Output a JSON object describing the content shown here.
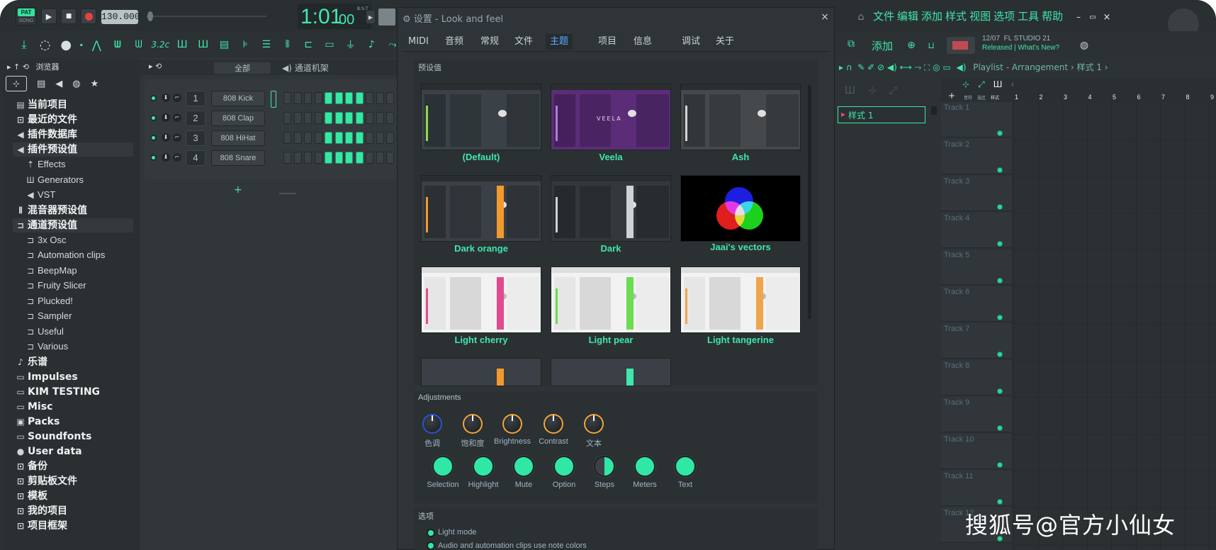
{
  "transport": {
    "pat": "PAT",
    "song": "SONG",
    "tempo": "130.000",
    "time_main": "1:01",
    "time_sub": "00",
    "bst": "B:S:T"
  },
  "menu": [
    "文件",
    "编辑",
    "添加",
    "样式",
    "视图",
    "选项",
    "工具",
    "帮助"
  ],
  "hint": {
    "date": "12/07",
    "app": "FL STUDIO 21",
    "line2": "Released | What's New?"
  },
  "playlist_bar": {
    "add": "添加",
    "title": "Playlist - Arrangement",
    "pattern": "样式 1"
  },
  "toolbar_small": {
    "sig": "3.2c"
  },
  "browser": {
    "title": "浏览器",
    "items": [
      {
        "icon": "file-icon",
        "label": "当前项目",
        "level": 0
      },
      {
        "icon": "folder-link-icon",
        "label": "最近的文件",
        "level": 0
      },
      {
        "icon": "plugin-icon",
        "label": "插件数据库",
        "level": 0
      },
      {
        "icon": "plugin-icon",
        "label": "插件预设值",
        "level": 0
      },
      {
        "icon": "plugin-link-icon",
        "label": "Effects",
        "level": 1
      },
      {
        "icon": "piano-icon",
        "label": "Generators",
        "level": 1
      },
      {
        "icon": "plugin-icon",
        "label": "VST",
        "level": 1
      },
      {
        "icon": "mixer-icon",
        "label": "混音器预设值",
        "level": 0
      },
      {
        "icon": "channel-icon",
        "label": "通道预设值",
        "level": 0
      },
      {
        "icon": "channel-icon",
        "label": "3x Osc",
        "level": 1
      },
      {
        "icon": "channel-icon",
        "label": "Automation clips",
        "level": 1
      },
      {
        "icon": "channel-icon",
        "label": "BeepMap",
        "level": 1
      },
      {
        "icon": "channel-icon",
        "label": "Fruity Slicer",
        "level": 1
      },
      {
        "icon": "channel-icon",
        "label": "Plucked!",
        "level": 1
      },
      {
        "icon": "channel-icon",
        "label": "Sampler",
        "level": 1
      },
      {
        "icon": "channel-icon",
        "label": "Useful",
        "level": 1
      },
      {
        "icon": "channel-icon",
        "label": "Various",
        "level": 1
      },
      {
        "icon": "note-icon",
        "label": "乐谱",
        "level": 0
      },
      {
        "icon": "folder-icon",
        "label": "Impulses",
        "level": 0
      },
      {
        "icon": "folder-icon",
        "label": "KIM TESTING",
        "level": 0
      },
      {
        "icon": "folder-icon",
        "label": "Misc",
        "level": 0
      },
      {
        "icon": "box-icon",
        "label": "Packs",
        "level": 0
      },
      {
        "icon": "folder-icon",
        "label": "Soundfonts",
        "level": 0
      },
      {
        "icon": "user-icon",
        "label": "User data",
        "level": 0
      },
      {
        "icon": "folder-link-icon",
        "label": "备份",
        "level": 0
      },
      {
        "icon": "folder-link-icon",
        "label": "剪贴板文件",
        "level": 0
      },
      {
        "icon": "folder-link-icon",
        "label": "模板",
        "level": 0
      },
      {
        "icon": "folder-link-icon",
        "label": "我的项目",
        "level": 0
      },
      {
        "icon": "folder-link-icon",
        "label": "项目框架",
        "level": 0
      }
    ]
  },
  "channel_rack": {
    "filter": "全部",
    "title": "通道机架",
    "channels": [
      {
        "num": "1",
        "name": "808 Kick"
      },
      {
        "num": "2",
        "name": "808 Clap"
      },
      {
        "num": "3",
        "name": "808 HiHat"
      },
      {
        "num": "4",
        "name": "808 Snare"
      }
    ],
    "add": "+"
  },
  "settings": {
    "title": "设置 - Look and feel",
    "tabs": [
      "MIDI",
      "音频",
      "常规",
      "文件",
      "主题",
      "项目",
      "信息",
      "调试",
      "关于"
    ],
    "active_tab": "主题",
    "presets_header": "预设值",
    "presets": [
      {
        "name": "(Default)",
        "accent": "#8fd94f",
        "bg": "#3a4247"
      },
      {
        "name": "Veela",
        "accent": "#b07bd8",
        "bg": "#5b2d78"
      },
      {
        "name": "Ash",
        "accent": "#d5d5d5",
        "bg": "#45494b"
      },
      {
        "name": "Dark orange",
        "accent": "#f29a2e",
        "bg": "#3a4045"
      },
      {
        "name": "Dark",
        "accent": "#cfd3d5",
        "bg": "#33383b"
      },
      {
        "name": "Jaai's vectors",
        "accent": "#ffffff",
        "bg": "#000000"
      },
      {
        "name": "Light cherry",
        "accent": "#e24a8f",
        "bg": "#f2f2f2"
      },
      {
        "name": "Light pear",
        "accent": "#6bdc50",
        "bg": "#f2f2f2"
      },
      {
        "name": "Light tangerine",
        "accent": "#f0a54a",
        "bg": "#f2f2f2"
      }
    ],
    "adjustments_header": "Adjustments",
    "knobs": [
      "色调",
      "饱和度",
      "Brightness",
      "Contrast",
      "文本"
    ],
    "colors": [
      "Selection",
      "Highlight",
      "Mute",
      "Option",
      "Steps",
      "Meters",
      "Text"
    ],
    "options_header": "选项",
    "options": [
      "Light mode",
      "Audio and automation clips use note colors"
    ]
  },
  "playlist": {
    "pattern": "样式 1",
    "bars": [
      "1",
      "2",
      "3",
      "4",
      "5",
      "6",
      "7",
      "8",
      "9"
    ],
    "tracks": [
      "Track 1",
      "Track 2",
      "Track 3",
      "Track 4",
      "Track 5",
      "Track 6",
      "Track 7",
      "Track 8",
      "Track 9",
      "Track 10",
      "Track 11",
      "Track 12"
    ],
    "mini_labels": [
      "音符",
      "选区",
      "样式"
    ]
  },
  "watermark": "搜狐号@官方小仙女"
}
